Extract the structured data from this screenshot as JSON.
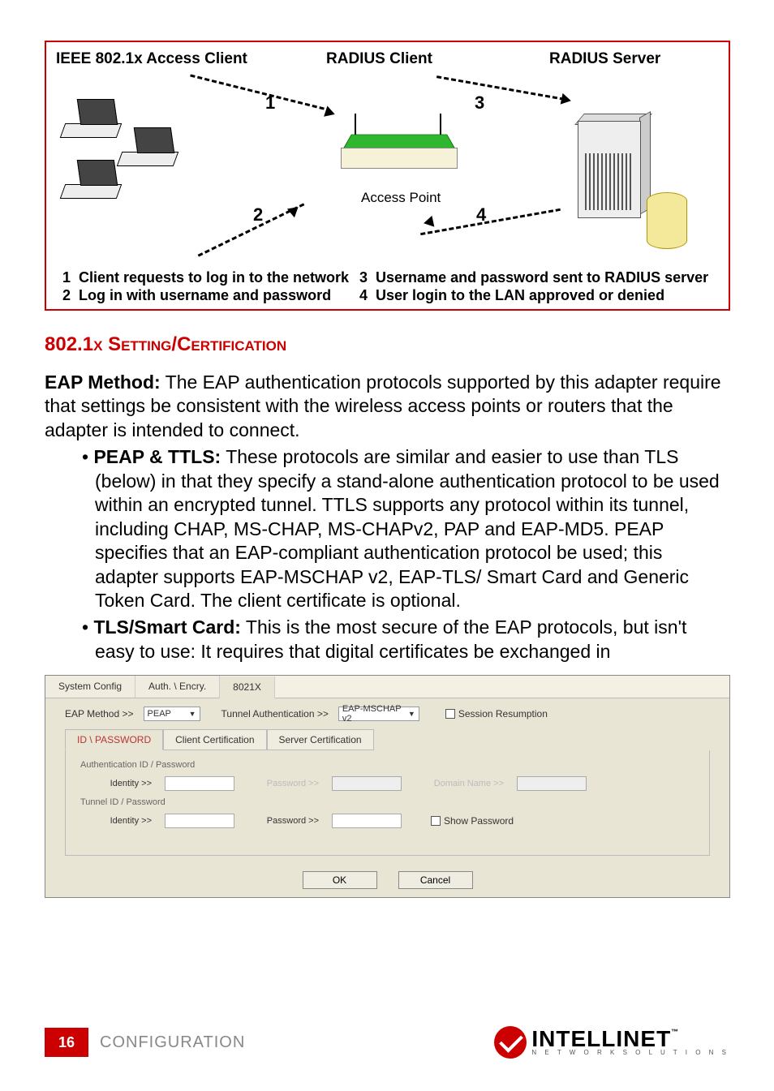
{
  "diagram": {
    "labels": {
      "access_client": "IEEE 802.1x Access Client",
      "radius_client": "RADIUS Client",
      "radius_server": "RADIUS Server",
      "access_point": "Access Point"
    },
    "arrows": {
      "n1": "1",
      "n2": "2",
      "n3": "3",
      "n4": "4"
    },
    "steps": {
      "s1_num": "1",
      "s1": "Client requests to log in to the network",
      "s2_num": "2",
      "s2": "Log in with username and password",
      "s3_num": "3",
      "s3": "Username and password sent to RADIUS server",
      "s4_num": "4",
      "s4": "User login to the LAN approved or denied"
    }
  },
  "heading": {
    "prefix": "802.1",
    "smallcaps": "x Setting/Certification"
  },
  "body": {
    "eap_label": "EAP Method:",
    "eap_text": " The EAP authentication protocols supported by this adapter require that settings be consistent with the wireless access points or routers that the adapter is intended to connect.",
    "peap_label": "PEAP & TTLS:",
    "peap_text": " These protocols are similar and easier to use than TLS (below) in that they specify a stand-alone authentication protocol to be used within an encrypted tunnel. TTLS supports any protocol within its tunnel, including CHAP, MS-CHAP, MS-CHAPv2, PAP and EAP-MD5. PEAP specifies that an EAP-compliant authentication protocol be used; this adapter supports EAP-MSCHAP v2, EAP-TLS/ Smart Card and Generic Token Card. The client certificate is optional.",
    "tls_label": "TLS/Smart Card:",
    "tls_text": " This is the most secure of the EAP protocols, but isn't easy to use: It requires that digital certificates be exchanged in"
  },
  "dialog": {
    "tabs": {
      "t1": "System Config",
      "t2": "Auth. \\ Encry.",
      "t3": "8021X"
    },
    "row1": {
      "eap_method_lbl": "EAP Method >>",
      "eap_method_val": "PEAP",
      "tunnel_auth_lbl": "Tunnel Authentication >>",
      "tunnel_auth_val": "EAP-MSCHAP v2",
      "session_resumption": "Session Resumption"
    },
    "subtabs": {
      "st1": "ID \\ PASSWORD",
      "st2": "Client Certification",
      "st3": "Server Certification"
    },
    "panel": {
      "group1": "Authentication ID / Password",
      "identity": "Identity >>",
      "password": "Password >>",
      "domain": "Domain Name >>",
      "group2": "Tunnel ID / Password",
      "show_pw": "Show Password"
    },
    "buttons": {
      "ok": "OK",
      "cancel": "Cancel"
    }
  },
  "footer": {
    "page": "16",
    "section": "CONFIGURATION",
    "logo_main": "INTELLINET",
    "logo_sub": "N E T W O R K   S O L U T I O N S",
    "tm": "™"
  }
}
